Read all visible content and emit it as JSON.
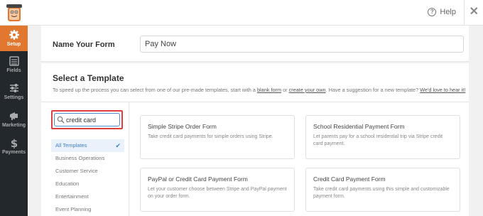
{
  "topbar": {
    "help_label": "Help",
    "help_glyph": "?",
    "close_glyph": "✕"
  },
  "sidebar": {
    "items": [
      {
        "label": "Setup",
        "icon": "gear-icon",
        "active": true
      },
      {
        "label": "Fields",
        "icon": "fields-list-icon",
        "active": false
      },
      {
        "label": "Settings",
        "icon": "sliders-icon",
        "active": false
      },
      {
        "label": "Marketing",
        "icon": "megaphone-icon",
        "active": false
      },
      {
        "label": "Payments",
        "icon": "dollar-icon",
        "active": false
      }
    ]
  },
  "form_name": {
    "label": "Name Your Form",
    "value": "Pay Now"
  },
  "templates": {
    "title": "Select a Template",
    "desc_prefix": "To speed up the process you can select from one of our pre-made templates, start with a ",
    "blank_link": "blank form",
    "desc_or": " or ",
    "create_link": "create your own",
    "desc_mid": ". Have a suggestion for a new template? ",
    "love_link": "We'd love to hear it!",
    "search_value": "credit card",
    "categories": [
      {
        "label": "All Templates",
        "selected": true
      },
      {
        "label": "Business Operations",
        "selected": false
      },
      {
        "label": "Customer Service",
        "selected": false
      },
      {
        "label": "Education",
        "selected": false
      },
      {
        "label": "Entertainment",
        "selected": false
      },
      {
        "label": "Event Planning",
        "selected": false
      }
    ],
    "cards": [
      {
        "title": "Simple Stripe Order Form",
        "desc": "Take credit card payments for simple orders using Stripe."
      },
      {
        "title": "School Residential Payment Form",
        "desc": "Let parents pay for a school residential trip via Stripe credit card payment."
      },
      {
        "title": "PayPal or Credit Card Payment Form",
        "desc": "Let your customer choose between Stripe and PayPal payment on your order form."
      },
      {
        "title": "Credit Card Payment Form",
        "desc": "Take credit card payments using this simple and customizable payment form."
      }
    ]
  },
  "colors": {
    "accent": "#e27730",
    "sidebar_bg": "#23282d",
    "search_highlight": "#e23d3d",
    "selected_blue": "#3d7fcb"
  }
}
